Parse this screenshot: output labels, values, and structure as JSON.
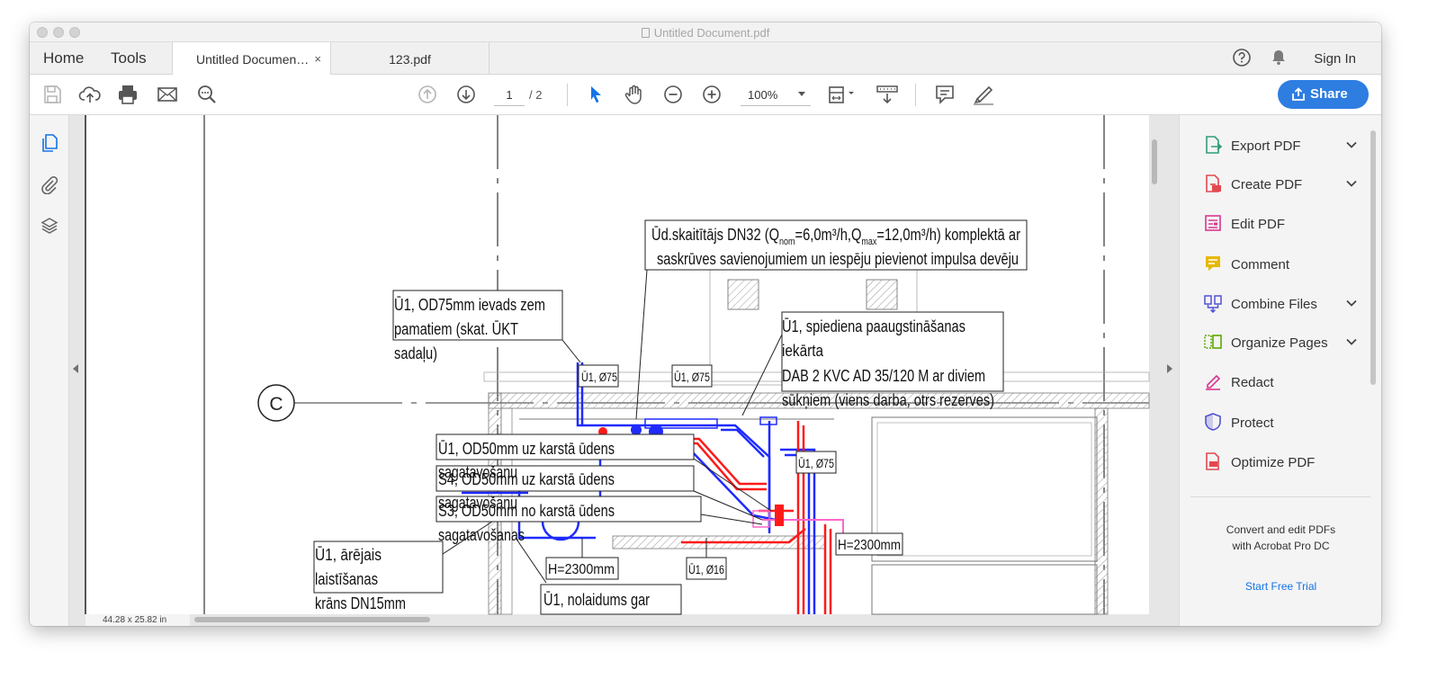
{
  "window": {
    "title": "Untitled Document.pdf"
  },
  "tabs": {
    "home": "Home",
    "tools": "Tools",
    "documents": [
      {
        "label": "Untitled Documen…",
        "close": "×",
        "active": true
      },
      {
        "label": "123.pdf",
        "active": false
      }
    ],
    "sign_in": "Sign In"
  },
  "toolbar": {
    "page_current": "1",
    "page_total": "/ 2",
    "zoom": "100%",
    "share": "Share"
  },
  "document": {
    "page_size": "44.28 x 25.82 in",
    "axis_marker": "C",
    "annotations": {
      "meter_line1": "Ūd.skaitītājs DN32 (Q",
      "meter_sub1": "nom",
      "meter_mid": "=6,0m³/h,Q",
      "meter_sub2": "max",
      "meter_end": "=12,0m³/h) komplektā ar",
      "meter_line2": "saskrūves savienojumiem un iespēju pievienot impulsa devēju",
      "inlet_1": "Ū1, OD75mm ievads zem",
      "inlet_2": "pamatiem (skat. ŪKT",
      "inlet_3": "sadaļu)",
      "pump_1": "Ū1, spiediena paaugstināšanas",
      "pump_2": "iekārta",
      "pump_3": "DAB 2 KVC AD 35/120 M ar diviem",
      "pump_4": "sūkņiem (viens darba, otrs rezerves)",
      "u1_d75_a": "Ū1, Ø75",
      "u1_d75_b": "Ū1, Ø75",
      "u1_d75_c": "Ū1, Ø75",
      "hot_a_1": "Ū1, OD50mm uz karstā ūdens",
      "hot_a_2": "sagatavošanu",
      "hot_b_1": "S4, OD50mm uz karstā ūdens",
      "hot_b_2": "sagatavošanu",
      "hot_c_1": "S3, OD50mm no karstā ūdens",
      "hot_c_2": "sagatavošanas",
      "tap_1": "Ū1, ārējais",
      "tap_2": "laistīšanas",
      "tap_3": "krāns DN15mm",
      "h_a": "H=2300mm",
      "h_b": "H=2300mm",
      "u1_d16": "Ū1, Ø16",
      "drain": "Ū1, nolaidums gar"
    }
  },
  "right_panel": {
    "tools": [
      {
        "label": "Export PDF",
        "icon": "export-pdf-icon",
        "color": "#2d9d78",
        "expandable": true
      },
      {
        "label": "Create PDF",
        "icon": "create-pdf-icon",
        "color": "#e34850",
        "expandable": true
      },
      {
        "label": "Edit PDF",
        "icon": "edit-pdf-icon",
        "color": "#d83790",
        "expandable": false
      },
      {
        "label": "Comment",
        "icon": "comment-icon",
        "color": "#e6b800",
        "expandable": false
      },
      {
        "label": "Combine Files",
        "icon": "combine-files-icon",
        "color": "#5151d3",
        "expandable": true
      },
      {
        "label": "Organize Pages",
        "icon": "organize-pages-icon",
        "color": "#5da800",
        "expandable": true
      },
      {
        "label": "Redact",
        "icon": "redact-icon",
        "color": "#d83790",
        "expandable": false
      },
      {
        "label": "Protect",
        "icon": "protect-icon",
        "color": "#5151d3",
        "expandable": false
      },
      {
        "label": "Optimize PDF",
        "icon": "optimize-pdf-icon",
        "color": "#e34850",
        "expandable": false
      }
    ],
    "promo_line1": "Convert and edit PDFs",
    "promo_line2": "with Acrobat Pro DC",
    "trial": "Start Free Trial"
  },
  "colors": {
    "accent": "#2e7de1",
    "link": "#1473e6",
    "pipe_cold": "#1f2bff",
    "pipe_hot": "#ff1a1a"
  }
}
